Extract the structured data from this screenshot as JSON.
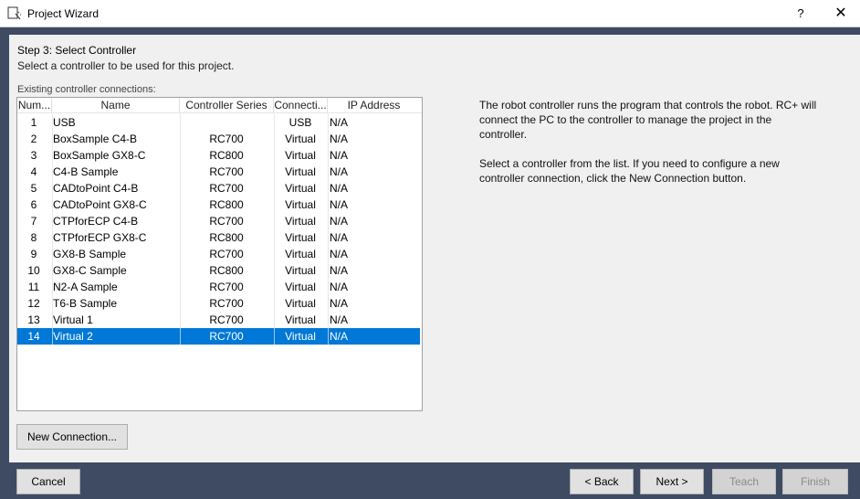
{
  "window": {
    "title": "Project Wizard",
    "help_label": "?",
    "close_label": "✕"
  },
  "step": {
    "title": "Step 3: Select Controller",
    "description": "Select a controller to be used for this project."
  },
  "list": {
    "label": "Existing controller connections:",
    "columns": [
      "Num...",
      "Name",
      "Controller Series",
      "Connecti...",
      "IP Address"
    ],
    "rows": [
      {
        "num": "1",
        "name": "USB",
        "series": "",
        "connection": "USB",
        "ip": "N/A"
      },
      {
        "num": "2",
        "name": "BoxSample C4-B",
        "series": "RC700",
        "connection": "Virtual",
        "ip": "N/A"
      },
      {
        "num": "3",
        "name": "BoxSample GX8-C",
        "series": "RC800",
        "connection": "Virtual",
        "ip": "N/A"
      },
      {
        "num": "4",
        "name": "C4-B Sample",
        "series": "RC700",
        "connection": "Virtual",
        "ip": "N/A"
      },
      {
        "num": "5",
        "name": "CADtoPoint C4-B",
        "series": "RC700",
        "connection": "Virtual",
        "ip": "N/A"
      },
      {
        "num": "6",
        "name": "CADtoPoint GX8-C",
        "series": "RC800",
        "connection": "Virtual",
        "ip": "N/A"
      },
      {
        "num": "7",
        "name": "CTPforECP C4-B",
        "series": "RC700",
        "connection": "Virtual",
        "ip": "N/A"
      },
      {
        "num": "8",
        "name": "CTPforECP GX8-C",
        "series": "RC800",
        "connection": "Virtual",
        "ip": "N/A"
      },
      {
        "num": "9",
        "name": "GX8-B Sample",
        "series": "RC700",
        "connection": "Virtual",
        "ip": "N/A"
      },
      {
        "num": "10",
        "name": "GX8-C Sample",
        "series": "RC800",
        "connection": "Virtual",
        "ip": "N/A"
      },
      {
        "num": "11",
        "name": "N2-A Sample",
        "series": "RC700",
        "connection": "Virtual",
        "ip": "N/A"
      },
      {
        "num": "12",
        "name": "T6-B Sample",
        "series": "RC700",
        "connection": "Virtual",
        "ip": "N/A"
      },
      {
        "num": "13",
        "name": "Virtual 1",
        "series": "RC700",
        "connection": "Virtual",
        "ip": "N/A"
      },
      {
        "num": "14",
        "name": "Virtual 2",
        "series": "RC700",
        "connection": "Virtual",
        "ip": "N/A"
      }
    ],
    "selected_index": 13
  },
  "info": {
    "paragraph1": "The robot controller runs the program that controls the robot.  RC+ will connect the PC to the controller to manage the project in the controller.",
    "paragraph2": "Select a controller from the list.  If you need to configure a new controller connection, click the New Connection button."
  },
  "buttons": {
    "new_connection": "New Connection...",
    "cancel": "Cancel",
    "back": "< Back",
    "next": "Next >",
    "teach": "Teach",
    "finish": "Finish"
  },
  "colors": {
    "selection": "#0078d7",
    "frame": "#3f4b63",
    "panel": "#f0f0f0"
  }
}
